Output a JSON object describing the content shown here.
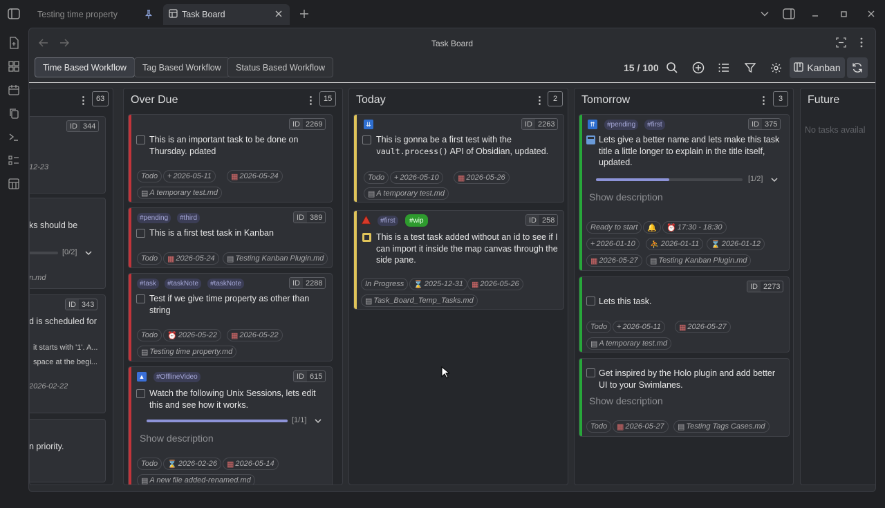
{
  "tabs": [
    {
      "label": "Testing time property",
      "pinned": true
    },
    {
      "label": "Task Board",
      "active": true
    }
  ],
  "view_title": "Task Board",
  "workflows": [
    "Time Based Workflow",
    "Tag Based Workflow",
    "Status Based Workflow"
  ],
  "selected_workflow": "Time Based Workflow",
  "counter": "15 / 100",
  "kanban_label": "Kanban",
  "colors": {
    "overdue": "#c2343a",
    "today": "#e0c45a",
    "tomorrow": "#27a83a",
    "accent": "#8d93d8"
  },
  "columns": {
    "partial": {
      "count": "63",
      "fragments": [
        "ID",
        "344",
        "12-23",
        "ks should be",
        "[0/2]",
        "n.md",
        "ID",
        "343",
        "d is scheduled for",
        "it starts with '1'. A...",
        "space at the begi...",
        "2026-02-22",
        "n priority."
      ]
    },
    "overdue": {
      "title": "Over Due",
      "count": "15"
    },
    "today": {
      "title": "Today",
      "count": "2"
    },
    "tomorrow": {
      "title": "Tomorrow",
      "count": "3"
    },
    "future": {
      "title": "Future",
      "empty_text": "No tasks availal"
    }
  },
  "cards": {
    "c2269": {
      "id_label": "ID",
      "id": "2269",
      "title": "This is an important task to be done on Thursday. pdated",
      "status": "Todo",
      "created": "2026-05-11",
      "due": "2026-05-24",
      "file": "A temporary test.md"
    },
    "c389": {
      "id_label": "ID",
      "id": "389",
      "tags": [
        "#pending",
        "#third"
      ],
      "title": "This is a first test task in Kanban",
      "status": "Todo",
      "due": "2026-05-24",
      "file": "Testing Kanban Plugin.md"
    },
    "c2288": {
      "id_label": "ID",
      "id": "2288",
      "tags": [
        "#task",
        "#taskNote",
        "#taskNote"
      ],
      "title": "Test if we give time property as other than string",
      "status": "Todo",
      "time": "2026-05-22",
      "due": "2026-05-22",
      "file": "Testing time property.md"
    },
    "c615": {
      "id_label": "ID",
      "id": "615",
      "tags": [
        "#OfflineVideo"
      ],
      "title": "Watch the following Unix Sessions, lets edit this and see how it works.",
      "progress": "[1/1]",
      "progress_value": 1.0,
      "show_description": "Show description",
      "status": "Todo",
      "scheduled": "2026-02-26",
      "due": "2026-05-14",
      "file": "A new file added-renamed.md"
    },
    "c2263": {
      "id_label": "ID",
      "id": "2263",
      "title_pre": "This is gonna be a first test with the",
      "title_code": "vault.process()",
      "title_post": "API of Obsidian, updated.",
      "status": "Todo",
      "created": "2026-05-10",
      "due": "2026-05-26",
      "file": "A temporary test.md"
    },
    "c258": {
      "id_label": "ID",
      "id": "258",
      "tags": [
        "#first",
        "#wip"
      ],
      "title": "This is a test task added without an id to see if I can import it inside the map canvas through the side pane.",
      "status": "In Progress",
      "scheduled": "2025-12-31",
      "due": "2026-05-26",
      "file": "Task_Board_Temp_Tasks.md"
    },
    "c375": {
      "id_label": "ID",
      "id": "375",
      "tags": [
        "#pending",
        "#first"
      ],
      "title": "Lets give a better name and lets make this task title a little longer to explain in the title itself, updated.",
      "progress": "[1/2]",
      "progress_value": 0.5,
      "show_description": "Show description",
      "status": "Ready to start",
      "time": "17:30 - 18:30",
      "created": "2026-01-10",
      "start": "2026-01-11",
      "scheduled": "2026-01-12",
      "due": "2026-05-27",
      "file": "Testing Kanban Plugin.md"
    },
    "c2273": {
      "id_label": "ID",
      "id": "2273",
      "title": "Lets this task.",
      "status": "Todo",
      "created": "2026-05-11",
      "due": "2026-05-27",
      "file": "A temporary test.md"
    },
    "cholo": {
      "title": "Get inspired by the Holo plugin and add better UI to your Swimlanes.",
      "show_description": "Show description",
      "status": "Todo",
      "due": "2026-05-27",
      "file": "Testing Tags Cases.md"
    }
  }
}
